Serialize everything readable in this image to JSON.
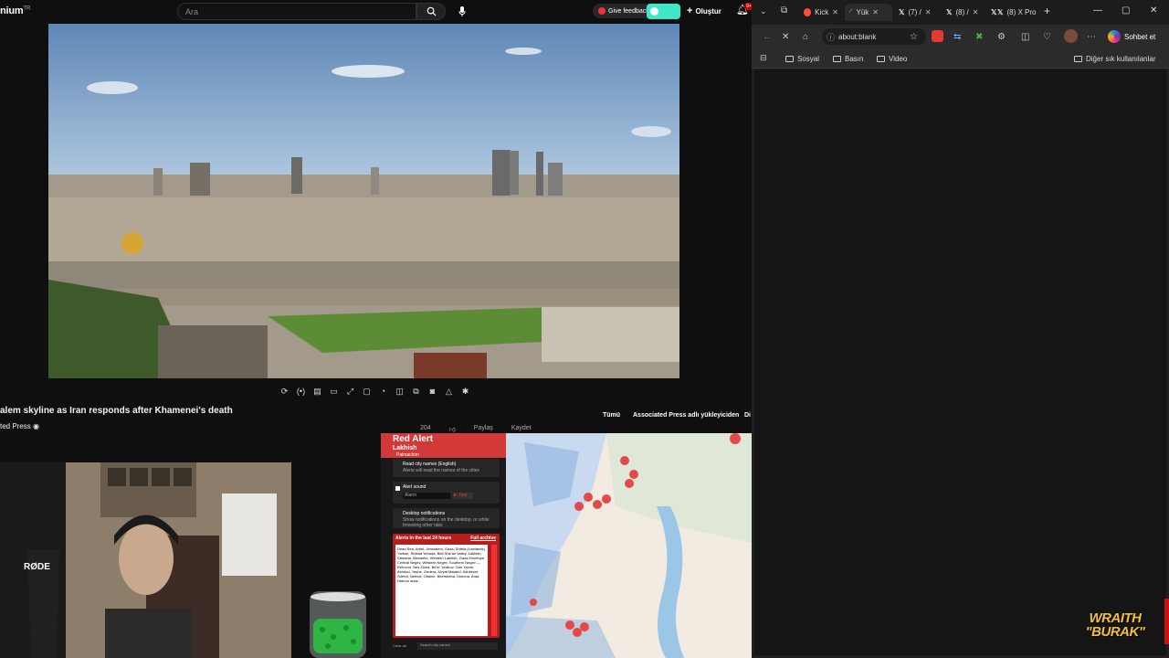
{
  "youtube": {
    "logo": "nium",
    "logo_sup": "TR",
    "search_placeholder": "Ara",
    "feedback_label": "Give feedback",
    "create_label": "Oluştur",
    "notif_badge": "9+",
    "video_title": "alem skyline as Iran responds after Khamenei's death",
    "channel": "ted Press",
    "filter_chips": [
      "Tümü",
      "Associated Press adlı yükleyiciden",
      "Di"
    ],
    "subrow": [
      "204",
      "",
      "Paylaş",
      "Kaydet"
    ]
  },
  "red_alert": {
    "title": "Red Alert",
    "location": "Lakhish",
    "sublocation": "Palmachim",
    "option1_title": "Read city names (English)",
    "option1_desc": "Alerts will read the names of the cities",
    "option2_title": "Alert sound",
    "option2_select": "Alarm",
    "option2_test": "► Test",
    "option3_title": "Desktop notifications",
    "option3_desc": "Show notifications on the desktop, or while browsing other tabs",
    "alerts_header": "Alerts in the last 24 hours",
    "alerts_link": "Full archive",
    "alerts_text": "Dead Sea, Arbel, Jerusalem, Gaza, Shfela (Lowlands), Yarkon, Shfelat Yehuda, Beit She'an Valley, Lakhish, Samaria, Menashe, Western Lakhish, Gaza Envelope, Central Negev, Western Negev, Southern Negev — Rehovot, Nes Ziona, Be'er Ya'akov, Gan Yavne, Ashdod, Yavne, Gedera, Kiryat Malakhi, Ashkelon, Sderot, Netivot, Ofakim, Beersheba, Dimona, Arad, Hebron area...",
    "bottom_left": "Clear all",
    "bottom_search": "Search city names"
  },
  "browser": {
    "tabs": [
      {
        "label": "Kick",
        "icon": "kick-icon"
      },
      {
        "label": "Yük",
        "icon": "loading-icon"
      },
      {
        "label": "(7) /",
        "icon": "x-logo-icon"
      },
      {
        "label": "(8) /",
        "icon": "x-logo-icon"
      },
      {
        "label": "",
        "icon": "x-logo-icon"
      },
      {
        "label": "(8) X Pro",
        "icon": "x-logo-icon"
      }
    ],
    "address": "about:blank",
    "chat_label": "Sohbet et",
    "favorites": [
      "Sosyal",
      "Basın",
      "Video"
    ],
    "other_favorites": "Diğer sık kullanılanlar"
  },
  "watermark": [
    "WRAITH",
    "\"BURAK\""
  ]
}
